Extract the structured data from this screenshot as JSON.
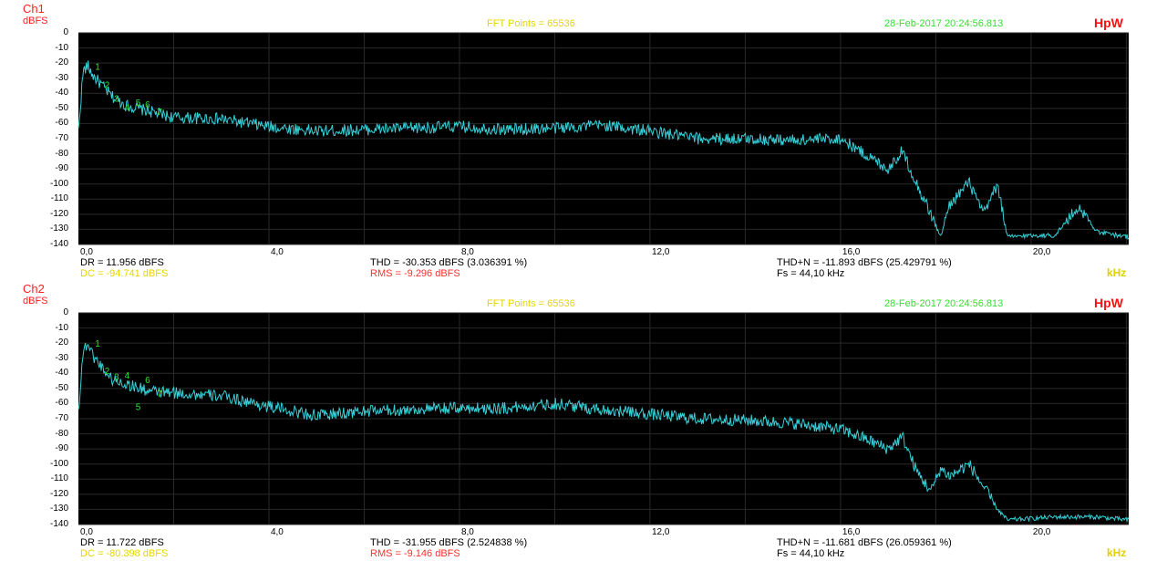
{
  "colors": {
    "trace": "#35d0d8",
    "grid": "#2a2a2a",
    "bg": "#000000",
    "harmonic": "#30e030",
    "dc": "#e6d500",
    "rms": "#ff3030",
    "timestamp": "#30e030",
    "fftpoints": "#e6d500",
    "brand": "#ff1010"
  },
  "brand": "HpW",
  "khz_label": "kHz",
  "panels": [
    {
      "channel": "Ch1",
      "unit": "dBFS",
      "fft_points": "FFT Points = 65536",
      "timestamp": "28-Feb-2017 20:24:56.813",
      "dr": "DR = 11.956 dBFS",
      "dc": "DC = -94.741 dBFS",
      "thd": "THD = -30.353 dBFS (3.036391 %)",
      "rms": "RMS = -9.296 dBFS",
      "thdn": "THD+N = -11.893 dBFS (25.429791 %)",
      "fs": "Fs = 44,10 kHz"
    },
    {
      "channel": "Ch2",
      "unit": "dBFS",
      "fft_points": "FFT Points = 65536",
      "timestamp": "28-Feb-2017 20:24:56.813",
      "dr": "DR = 11.722 dBFS",
      "dc": "DC = -80.398 dBFS",
      "thd": "THD = -31.955 dBFS (2.524838 %)",
      "rms": "RMS = -9.146 dBFS",
      "thdn": "THD+N = -11.681 dBFS (26.059361 %)",
      "fs": "Fs = 44,10 kHz"
    }
  ],
  "chart_data": [
    {
      "type": "line",
      "title": "FFT Points = 65536",
      "xlabel": "kHz",
      "ylabel": "dBFS",
      "xlim": [
        0,
        22.05
      ],
      "ylim": [
        -140,
        0
      ],
      "x_ticks": [
        "0,0",
        "4,0",
        "8,0",
        "12,0",
        "16,0",
        "20,0"
      ],
      "y_ticks": [
        "0",
        "-10",
        "-20",
        "-30",
        "-40",
        "-50",
        "-60",
        "-70",
        "-80",
        "-90",
        "-100",
        "-110",
        "-120",
        "-130",
        "-140"
      ],
      "grid": true,
      "harmonic_markers": [
        {
          "label": "1",
          "x": 0.35,
          "y": -22
        },
        {
          "label": "2",
          "x": 0.55,
          "y": -34
        },
        {
          "label": "3",
          "x": 0.75,
          "y": -43
        },
        {
          "label": "4",
          "x": 0.97,
          "y": -49
        },
        {
          "label": "5",
          "x": 1.2,
          "y": -46
        },
        {
          "label": "6",
          "x": 1.4,
          "y": -47
        },
        {
          "label": "7",
          "x": 1.65,
          "y": -52
        }
      ],
      "series": [
        {
          "x": [
            0,
            0.1,
            0.2,
            0.3,
            0.5,
            0.7,
            1.0,
            1.5,
            2.0,
            3.0,
            4.0,
            5.0,
            6.0,
            7.0,
            8.0,
            9.0,
            10.0,
            11.0,
            12.0,
            13.0,
            14.0,
            15.0,
            16.0,
            16.5,
            17.0,
            17.3,
            17.6,
            17.9,
            18.1,
            18.3,
            18.7,
            19.0,
            19.3,
            19.5,
            20.0,
            20.5,
            21.0,
            21.4,
            22.05
          ],
          "y": [
            -65,
            -25,
            -22,
            -28,
            -35,
            -42,
            -48,
            -52,
            -56,
            -57,
            -62,
            -65,
            -64,
            -63,
            -62,
            -64,
            -63,
            -61,
            -65,
            -70,
            -70,
            -71,
            -70,
            -80,
            -90,
            -78,
            -100,
            -120,
            -135,
            -113,
            -99,
            -120,
            -100,
            -135,
            -134,
            -134,
            -115,
            -132,
            -135
          ]
        }
      ]
    },
    {
      "type": "line",
      "title": "FFT Points = 65536",
      "xlabel": "kHz",
      "ylabel": "dBFS",
      "xlim": [
        0,
        22.05
      ],
      "ylim": [
        -140,
        0
      ],
      "x_ticks": [
        "0,0",
        "4,0",
        "8,0",
        "12,0",
        "16,0",
        "20,0"
      ],
      "y_ticks": [
        "0",
        "-10",
        "-20",
        "-30",
        "-40",
        "-50",
        "-60",
        "-70",
        "-80",
        "-90",
        "-100",
        "-110",
        "-120",
        "-130",
        "-140"
      ],
      "grid": true,
      "harmonic_markers": [
        {
          "label": "1",
          "x": 0.35,
          "y": -20
        },
        {
          "label": "2",
          "x": 0.55,
          "y": -38
        },
        {
          "label": "3",
          "x": 0.75,
          "y": -42
        },
        {
          "label": "4",
          "x": 0.97,
          "y": -41
        },
        {
          "label": "5",
          "x": 1.2,
          "y": -62
        },
        {
          "label": "6",
          "x": 1.4,
          "y": -44
        },
        {
          "label": "7",
          "x": 1.65,
          "y": -53
        }
      ],
      "series": [
        {
          "x": [
            0,
            0.1,
            0.2,
            0.3,
            0.5,
            0.7,
            1.0,
            1.5,
            2.0,
            3.0,
            4.0,
            5.0,
            6.0,
            7.0,
            8.0,
            9.0,
            10.0,
            11.0,
            12.0,
            13.0,
            14.0,
            15.0,
            16.0,
            16.5,
            17.0,
            17.3,
            17.6,
            17.9,
            18.1,
            18.3,
            18.7,
            19.0,
            19.3,
            19.5,
            20.0,
            20.5,
            21.0,
            21.4,
            22.05
          ],
          "y": [
            -65,
            -25,
            -20,
            -28,
            -36,
            -44,
            -47,
            -52,
            -53,
            -55,
            -62,
            -68,
            -65,
            -64,
            -63,
            -63,
            -60,
            -64,
            -67,
            -70,
            -71,
            -73,
            -77,
            -83,
            -90,
            -82,
            -105,
            -118,
            -103,
            -108,
            -100,
            -115,
            -130,
            -137,
            -136,
            -135,
            -135,
            -135,
            -137
          ]
        }
      ]
    }
  ]
}
